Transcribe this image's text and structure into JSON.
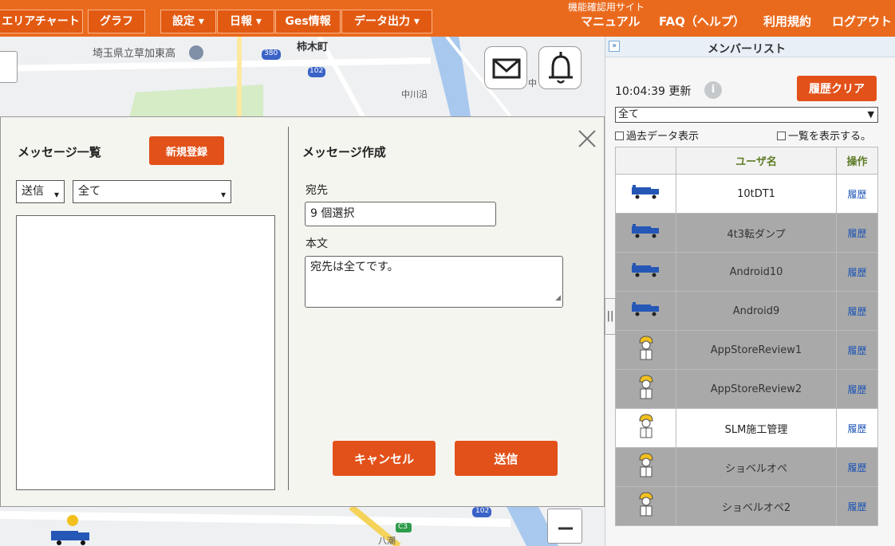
{
  "topbar": {
    "site_label": "機能確認用サイト",
    "nav": [
      "エリアチャート",
      "グラフ",
      "設定 ▾",
      "日報 ▾",
      "Ges情報",
      "データ出力 ▾"
    ],
    "links": [
      "マニュアル",
      "FAQ（ヘルプ）",
      "利用規約",
      "ログアウト"
    ]
  },
  "map": {
    "labels": [
      "埼玉県立草加東高",
      "柿木町",
      "中",
      "中川沿",
      "380",
      "102",
      "102",
      "C3",
      "八潮"
    ]
  },
  "member_panel": {
    "title": "メンバーリスト",
    "update_time": "10:04:39 更新",
    "info_icon": "i",
    "clear_button": "履歴クリア",
    "filter_value": "全て",
    "past_data_checkbox": "過去データ表示",
    "show_list_checkbox": "一覧を表示する。",
    "columns": [
      "",
      "ユーザ名",
      "操作"
    ],
    "rows": [
      {
        "icon": "truck-icon",
        "name": "10tDT1",
        "action": "履歴",
        "active": true
      },
      {
        "icon": "truck-icon",
        "name": "4t3転ダンプ",
        "action": "履歴",
        "active": false
      },
      {
        "icon": "truck-icon",
        "name": "Android10",
        "action": "履歴",
        "active": false
      },
      {
        "icon": "truck-icon",
        "name": "Android9",
        "action": "履歴",
        "active": false
      },
      {
        "icon": "worker-icon",
        "name": "AppStoreReview1",
        "action": "履歴",
        "active": false
      },
      {
        "icon": "worker-icon",
        "name": "AppStoreReview2",
        "action": "履歴",
        "active": false
      },
      {
        "icon": "worker-icon",
        "name": "SLM施工管理",
        "action": "履歴",
        "active": true
      },
      {
        "icon": "worker-icon",
        "name": "ショベルオペ",
        "action": "履歴",
        "active": false
      },
      {
        "icon": "worker-icon",
        "name": "ショベルオペ2",
        "action": "履歴",
        "active": false
      }
    ]
  },
  "dialog": {
    "list_title": "メッセージ一覧",
    "new_button": "新規登録",
    "direction_value": "送信",
    "category_value": "全て",
    "compose_title": "メッセージ作成",
    "recipient_label": "宛先",
    "recipient_value": "9 個選択",
    "body_label": "本文",
    "body_value": "宛先は全てです。",
    "cancel_button": "キャンセル",
    "send_button": "送信"
  },
  "colors": {
    "header_orange": "#ea6a1d",
    "button_orange": "#e2511a",
    "inactive_row": "#a9a9a9",
    "link_blue": "#1a53b5"
  }
}
